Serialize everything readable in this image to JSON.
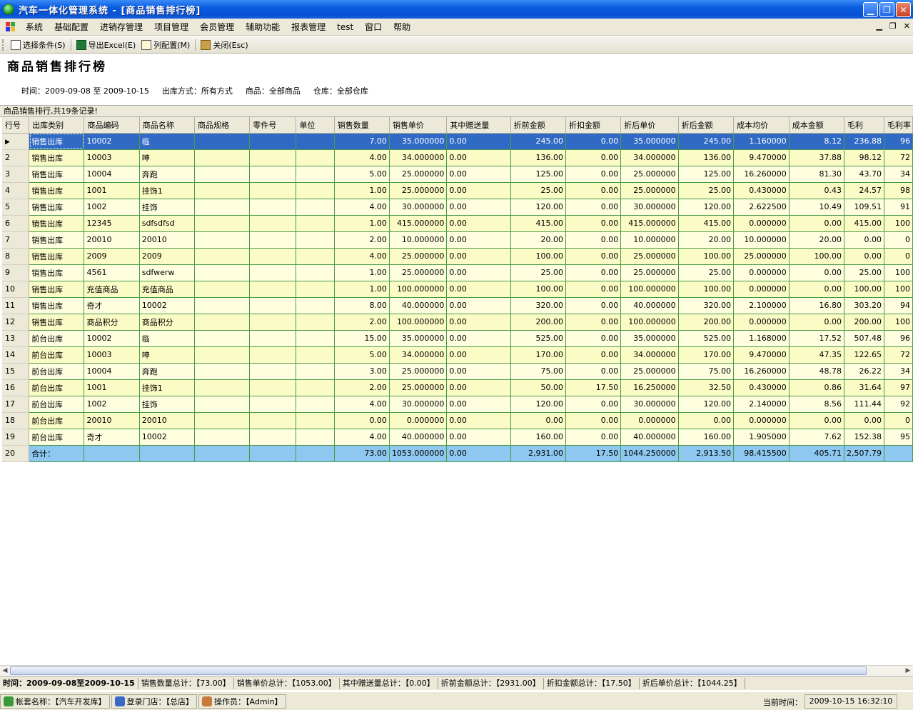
{
  "window": {
    "title": "汽车一体化管理系统 - [商品销售排行榜]"
  },
  "menu": [
    "系统",
    "基础配置",
    "进销存管理",
    "项目管理",
    "会员管理",
    "辅助功能",
    "报表管理",
    "test",
    "窗口",
    "帮助"
  ],
  "toolbar": {
    "select_label": "选择条件(S)",
    "export_label": "导出Excel(E)",
    "columns_label": "列配置(M)",
    "close_label": "关闭(Esc)"
  },
  "report": {
    "title": "商品销售排行榜",
    "time": "时间：2009-09-08 至 2009-10-15",
    "method": "出库方式：所有方式",
    "goods": "商品：全部商品",
    "warehouse": "仓库：全部仓库",
    "record_info": "商品销售排行,共19条记录!"
  },
  "grid": {
    "columns": [
      "行号",
      "出库类别",
      "商品编码",
      "商品名称",
      "商品规格",
      "零件号",
      "单位",
      "销售数量",
      "销售单价",
      "其中赠送量",
      "折前金额",
      "折扣金额",
      "折后单价",
      "折后金额",
      "成本均价",
      "成本金额",
      "毛利",
      "毛利率"
    ],
    "rows": [
      [
        "",
        "销售出库",
        "10002",
        "临",
        "",
        "",
        "",
        "7.00",
        "35.000000",
        "0.00",
        "245.00",
        "0.00",
        "35.000000",
        "245.00",
        "1.160000",
        "8.12",
        "236.88",
        "96"
      ],
      [
        "2",
        "销售出库",
        "10003",
        "呻",
        "",
        "",
        "",
        "4.00",
        "34.000000",
        "0.00",
        "136.00",
        "0.00",
        "34.000000",
        "136.00",
        "9.470000",
        "37.88",
        "98.12",
        "72"
      ],
      [
        "3",
        "销售出库",
        "10004",
        "奔跑",
        "",
        "",
        "",
        "5.00",
        "25.000000",
        "0.00",
        "125.00",
        "0.00",
        "25.000000",
        "125.00",
        "16.260000",
        "81.30",
        "43.70",
        "34"
      ],
      [
        "4",
        "销售出库",
        "1001",
        "挂饰1",
        "",
        "",
        "",
        "1.00",
        "25.000000",
        "0.00",
        "25.00",
        "0.00",
        "25.000000",
        "25.00",
        "0.430000",
        "0.43",
        "24.57",
        "98"
      ],
      [
        "5",
        "销售出库",
        "1002",
        "挂饰",
        "",
        "",
        "",
        "4.00",
        "30.000000",
        "0.00",
        "120.00",
        "0.00",
        "30.000000",
        "120.00",
        "2.622500",
        "10.49",
        "109.51",
        "91"
      ],
      [
        "6",
        "销售出库",
        "12345",
        "sdfsdfsd",
        "",
        "",
        "",
        "1.00",
        "415.000000",
        "0.00",
        "415.00",
        "0.00",
        "415.000000",
        "415.00",
        "0.000000",
        "0.00",
        "415.00",
        "100"
      ],
      [
        "7",
        "销售出库",
        "20010",
        "20010",
        "",
        "",
        "",
        "2.00",
        "10.000000",
        "0.00",
        "20.00",
        "0.00",
        "10.000000",
        "20.00",
        "10.000000",
        "20.00",
        "0.00",
        "0"
      ],
      [
        "8",
        "销售出库",
        "2009",
        "2009",
        "",
        "",
        "",
        "4.00",
        "25.000000",
        "0.00",
        "100.00",
        "0.00",
        "25.000000",
        "100.00",
        "25.000000",
        "100.00",
        "0.00",
        "0"
      ],
      [
        "9",
        "销售出库",
        "4561",
        "sdfwerw",
        "",
        "",
        "",
        "1.00",
        "25.000000",
        "0.00",
        "25.00",
        "0.00",
        "25.000000",
        "25.00",
        "0.000000",
        "0.00",
        "25.00",
        "100"
      ],
      [
        "10",
        "销售出库",
        "充值商品",
        "充值商品",
        "",
        "",
        "",
        "1.00",
        "100.000000",
        "0.00",
        "100.00",
        "0.00",
        "100.000000",
        "100.00",
        "0.000000",
        "0.00",
        "100.00",
        "100"
      ],
      [
        "11",
        "销售出库",
        "奇才",
        "10002",
        "",
        "",
        "",
        "8.00",
        "40.000000",
        "0.00",
        "320.00",
        "0.00",
        "40.000000",
        "320.00",
        "2.100000",
        "16.80",
        "303.20",
        "94"
      ],
      [
        "12",
        "销售出库",
        "商品积分",
        "商品积分",
        "",
        "",
        "",
        "2.00",
        "100.000000",
        "0.00",
        "200.00",
        "0.00",
        "100.000000",
        "200.00",
        "0.000000",
        "0.00",
        "200.00",
        "100"
      ],
      [
        "13",
        "前台出库",
        "10002",
        "临",
        "",
        "",
        "",
        "15.00",
        "35.000000",
        "0.00",
        "525.00",
        "0.00",
        "35.000000",
        "525.00",
        "1.168000",
        "17.52",
        "507.48",
        "96"
      ],
      [
        "14",
        "前台出库",
        "10003",
        "呻",
        "",
        "",
        "",
        "5.00",
        "34.000000",
        "0.00",
        "170.00",
        "0.00",
        "34.000000",
        "170.00",
        "9.470000",
        "47.35",
        "122.65",
        "72"
      ],
      [
        "15",
        "前台出库",
        "10004",
        "奔跑",
        "",
        "",
        "",
        "3.00",
        "25.000000",
        "0.00",
        "75.00",
        "0.00",
        "25.000000",
        "75.00",
        "16.260000",
        "48.78",
        "26.22",
        "34"
      ],
      [
        "16",
        "前台出库",
        "1001",
        "挂饰1",
        "",
        "",
        "",
        "2.00",
        "25.000000",
        "0.00",
        "50.00",
        "17.50",
        "16.250000",
        "32.50",
        "0.430000",
        "0.86",
        "31.64",
        "97"
      ],
      [
        "17",
        "前台出库",
        "1002",
        "挂饰",
        "",
        "",
        "",
        "4.00",
        "30.000000",
        "0.00",
        "120.00",
        "0.00",
        "30.000000",
        "120.00",
        "2.140000",
        "8.56",
        "111.44",
        "92"
      ],
      [
        "18",
        "前台出库",
        "20010",
        "20010",
        "",
        "",
        "",
        "0.00",
        "0.000000",
        "0.00",
        "0.00",
        "0.00",
        "0.000000",
        "0.00",
        "0.000000",
        "0.00",
        "0.00",
        "0"
      ],
      [
        "19",
        "前台出库",
        "奇才",
        "10002",
        "",
        "",
        "",
        "4.00",
        "40.000000",
        "0.00",
        "160.00",
        "0.00",
        "40.000000",
        "160.00",
        "1.905000",
        "7.62",
        "152.38",
        "95"
      ]
    ],
    "total": [
      "20",
      "合计：",
      "",
      "",
      "",
      "",
      "",
      "73.00",
      "1053.000000",
      "0.00",
      "2,931.00",
      "17.50",
      "1044.250000",
      "2,913.50",
      "98.415500",
      "405.71",
      "2,507.79",
      ""
    ]
  },
  "summary": [
    "时间：2009-09-08至2009-10-15",
    "销售数量总计：【73.00】",
    "销售单价总计：【1053.00】",
    "其中赠送量总计：【0.00】",
    "折前金额总计：【2931.00】",
    "折扣金额总计：【17.50】",
    "折后单价总计：【1044.25】"
  ],
  "status": {
    "account": "帐套名称：【汽车开发库】",
    "store": "登录门店：【总店】",
    "operator": "操作员：【Admin】",
    "time_label": "当前时间：",
    "time": "2009-10-15 16:32:10"
  },
  "colors": {
    "title_bar": "#0a5ce0",
    "row_odd": "#ffffe0",
    "row_even": "#fbfbc6",
    "selected": "#316ac5",
    "total": "#8ec8f0"
  }
}
